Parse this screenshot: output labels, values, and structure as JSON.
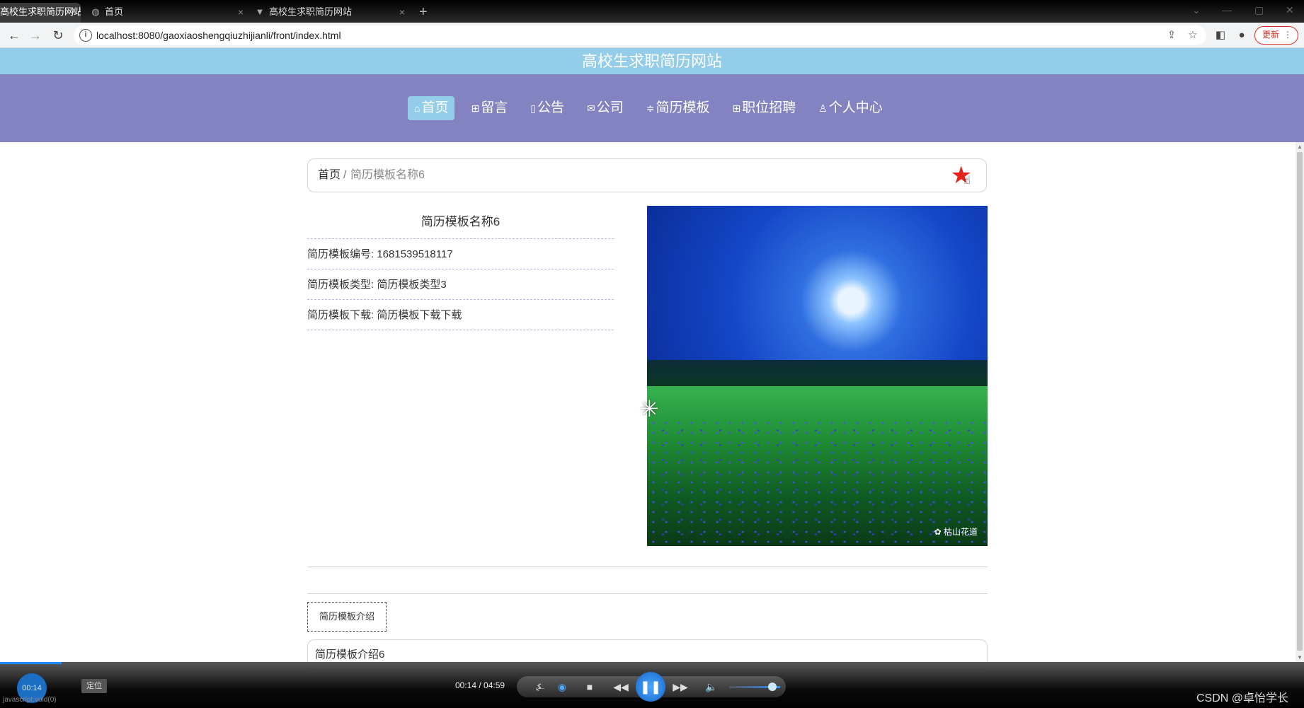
{
  "browser": {
    "tabs": [
      {
        "title": "高校生求职简历网站",
        "icon": "vue-logo-icon",
        "active": true
      },
      {
        "title": "首页",
        "icon": "globe-icon",
        "active": false
      },
      {
        "title": "高校生求职简历网站",
        "icon": "vue-logo-icon",
        "active": false
      }
    ],
    "new_tab": "+",
    "url": "localhost:8080/gaoxiaoshengqiuzhijianli/front/index.html",
    "update_label": "更新"
  },
  "site": {
    "title": "高校生求职简历网站",
    "nav": [
      {
        "label": "首页",
        "icon": "home-icon",
        "active": true
      },
      {
        "label": "留言",
        "icon": "message-icon",
        "active": false
      },
      {
        "label": "公告",
        "icon": "notice-icon",
        "active": false
      },
      {
        "label": "公司",
        "icon": "mail-icon",
        "active": false
      },
      {
        "label": "简历模板",
        "icon": "list-icon",
        "active": false
      },
      {
        "label": "职位招聘",
        "icon": "grid-icon",
        "active": false
      },
      {
        "label": "个人中心",
        "icon": "user-icon",
        "active": false
      }
    ],
    "colors": {
      "title_bar": "#94cdea",
      "nav_bar": "#8283c0",
      "favorite_star": "#e5231c"
    }
  },
  "breadcrumb": {
    "home": "首页",
    "separator": "/",
    "current": "简历模板名称6"
  },
  "detail": {
    "title": "简历模板名称6",
    "fields": [
      {
        "label": "简历模板编号:",
        "value": "1681539518117"
      },
      {
        "label": "简历模板类型:",
        "value": "简历模板类型3"
      },
      {
        "label": "简历模板下载:",
        "value": "简历模板下载下载"
      }
    ],
    "image": {
      "description_icon": "moonlit-meadow-photo",
      "watermark": "枯山花道"
    },
    "intro_tab": "简历模板介绍",
    "intro_text": "简历模板介绍6"
  },
  "player": {
    "badge_time": "00:14",
    "locate_label": "定位",
    "status_text": "javascript:void(0)",
    "time": "00:14 / 04:59",
    "progress": 0.047,
    "volume": 0.75,
    "brand": "CSDN @卓怡学长"
  }
}
